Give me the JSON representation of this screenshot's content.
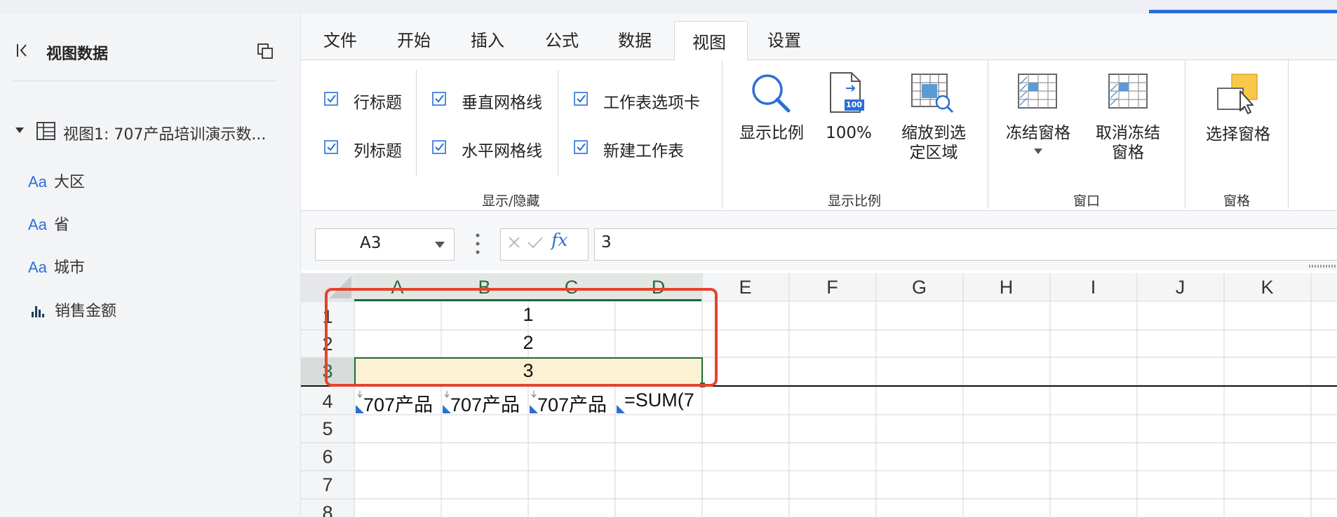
{
  "sidebar": {
    "title": "视图数据",
    "view_label": "视图1: 707产品培训演示数...",
    "fields": [
      {
        "prefix": "Aa",
        "label": "大区",
        "icon": "text-field-icon"
      },
      {
        "prefix": "Aa",
        "label": "省",
        "icon": "text-field-icon"
      },
      {
        "prefix": "Aa",
        "label": "城市",
        "icon": "text-field-icon"
      },
      {
        "prefix": "",
        "label": "销售金额",
        "icon": "bar-chart-icon"
      }
    ]
  },
  "ribbon": {
    "tabs": [
      "文件",
      "开始",
      "插入",
      "公式",
      "数据",
      "视图",
      "设置"
    ],
    "active_tab": "视图",
    "show_hide": {
      "items": [
        "行标题",
        "列标题",
        "垂直网格线",
        "水平网格线",
        "工作表选项卡",
        "新建工作表"
      ],
      "group_label": "显示/隐藏"
    },
    "zoom": {
      "zoom_label": "显示比例",
      "zoom100_label": "100%",
      "zoom100_badge": "100",
      "zoom_to_sel_line1": "缩放到选",
      "zoom_to_sel_line2": "定区域",
      "group_label": "显示比例"
    },
    "window": {
      "freeze_label": "冻结窗格",
      "unfreeze_line1": "取消冻结",
      "unfreeze_line2": "窗格",
      "group_label": "窗口"
    },
    "pane": {
      "select_pane_label": "选择窗格",
      "group_label": "窗格"
    }
  },
  "formula_bar": {
    "name_box": "A3",
    "fx_symbol": "fx",
    "value": "3"
  },
  "sheet": {
    "columns": [
      "A",
      "B",
      "C",
      "D",
      "E",
      "F",
      "G",
      "H",
      "I",
      "J",
      "K"
    ],
    "rows": [
      "1",
      "2",
      "3",
      "4",
      "5",
      "6",
      "7",
      "8"
    ],
    "merged_values": [
      "1",
      "2",
      "3"
    ],
    "row4": [
      "707产品",
      "707产品",
      "707产品",
      "=SUM(7"
    ],
    "selected_cell": "A3"
  },
  "colors": {
    "accent": "#2a6fd6",
    "selection_fill": "#fdf1d3",
    "selection_border": "#1f6b3a",
    "highlight_box": "#e5432e"
  }
}
